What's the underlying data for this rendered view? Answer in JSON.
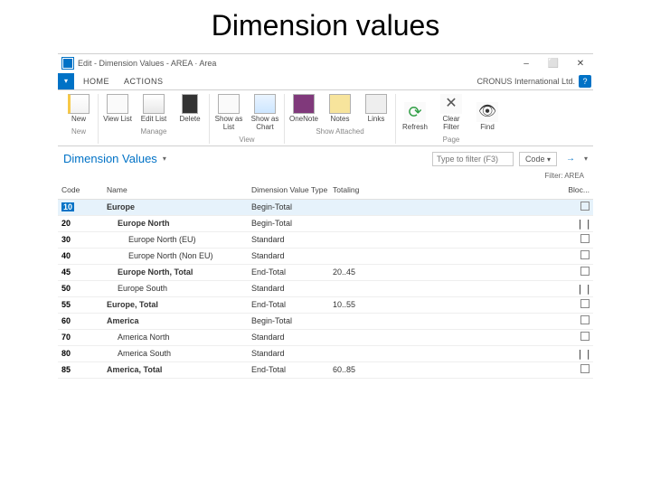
{
  "slide": {
    "title": "Dimension values"
  },
  "window": {
    "caption": "Edit - Dimension Values - AREA · Area",
    "minimize": "–",
    "maximize": "⬜",
    "close": "✕"
  },
  "tabs": {
    "home": "HOME",
    "actions": "ACTIONS"
  },
  "company": "CRONUS International Ltd.",
  "help": "?",
  "ribbon": {
    "new": "New",
    "viewlist": "View List",
    "editlist": "Edit List",
    "delete": "Delete",
    "showlist": "Show as List",
    "showchart": "Show as Chart",
    "onenote": "OneNote",
    "notes": "Notes",
    "links": "Links",
    "refresh": "Refresh",
    "clearfilter": "Clear Filter",
    "find": "Find",
    "g_new": "New",
    "g_manage": "Manage",
    "g_view": "View",
    "g_attached": "Show Attached",
    "g_page": "Page"
  },
  "page": {
    "title": "Dimension Values",
    "filter_placeholder": "Type to filter (F3)",
    "filter_field": "Code",
    "arrow": "→",
    "filter_info": "Filter: AREA"
  },
  "columns": {
    "code": "Code",
    "name": "Name",
    "dvtype": "Dimension Value Type",
    "totaling": "Totaling",
    "bloc": "Bloc..."
  },
  "rows": [
    {
      "code": "10",
      "name": "Europe",
      "indent": 0,
      "bold": true,
      "dvtype": "Begin-Total",
      "totaling": "",
      "bloc": "empty",
      "selected": true
    },
    {
      "code": "20",
      "name": "Europe North",
      "indent": 1,
      "bold": true,
      "dvtype": "Begin-Total",
      "totaling": "",
      "bloc": "pause"
    },
    {
      "code": "30",
      "name": "Europe North (EU)",
      "indent": 2,
      "bold": false,
      "dvtype": "Standard",
      "totaling": "",
      "bloc": "empty"
    },
    {
      "code": "40",
      "name": "Europe North (Non EU)",
      "indent": 2,
      "bold": false,
      "dvtype": "Standard",
      "totaling": "",
      "bloc": "empty"
    },
    {
      "code": "45",
      "name": "Europe North, Total",
      "indent": 1,
      "bold": true,
      "dvtype": "End-Total",
      "totaling": "20..45",
      "bloc": "empty"
    },
    {
      "code": "50",
      "name": "Europe South",
      "indent": 1,
      "bold": false,
      "dvtype": "Standard",
      "totaling": "",
      "bloc": "pause"
    },
    {
      "code": "55",
      "name": "Europe, Total",
      "indent": 0,
      "bold": true,
      "dvtype": "End-Total",
      "totaling": "10..55",
      "bloc": "empty"
    },
    {
      "code": "60",
      "name": "America",
      "indent": 0,
      "bold": true,
      "dvtype": "Begin-Total",
      "totaling": "",
      "bloc": "empty"
    },
    {
      "code": "70",
      "name": "America North",
      "indent": 1,
      "bold": false,
      "dvtype": "Standard",
      "totaling": "",
      "bloc": "empty"
    },
    {
      "code": "80",
      "name": "America South",
      "indent": 1,
      "bold": false,
      "dvtype": "Standard",
      "totaling": "",
      "bloc": "pause"
    },
    {
      "code": "85",
      "name": "America, Total",
      "indent": 0,
      "bold": true,
      "dvtype": "End-Total",
      "totaling": "60..85",
      "bloc": "empty"
    }
  ]
}
